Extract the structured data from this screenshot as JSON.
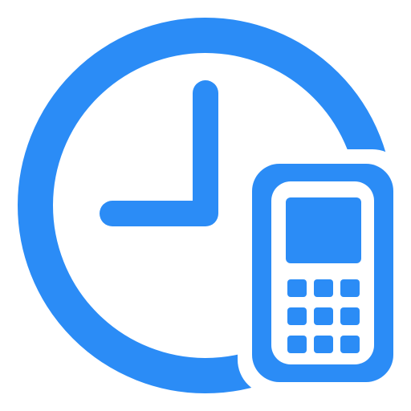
{
  "icon": {
    "name": "clock-with-mobile-phone",
    "accent_color": "#2b8cf6",
    "background_color": "#ffffff",
    "elements": [
      "clock-icon",
      "mobile-phone-icon"
    ]
  }
}
